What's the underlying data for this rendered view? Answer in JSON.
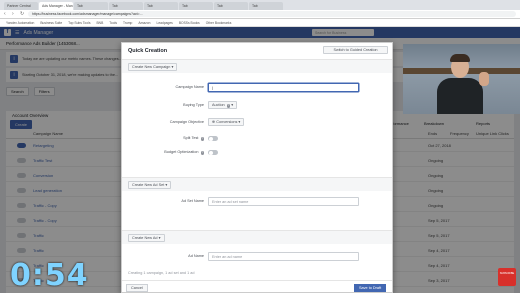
{
  "browser": {
    "tabs": [
      "Partner Central",
      "Ads Manager - Manage Ads",
      "Tab",
      "Tab",
      "Tab",
      "Tab",
      "Tab",
      "Tab"
    ],
    "url": "https://business.facebook.com/adsmanager/manage/campaigns?act=...",
    "bookmarks": [
      "Yandex Automation",
      "Business Suite",
      "Top Subs Tools",
      "BNB",
      "Tools",
      "Trump",
      "Amazon",
      "Leadpages",
      "BOSSs Books",
      "Other Bookmarks"
    ]
  },
  "fb": {
    "app_title": "Ads Manager",
    "search_placeholder": "Search for Business",
    "account_name": "Performance Ads Builder (1453068...",
    "notice_1": "Today we are updating our metric names. These changes...",
    "notice_2": "Starting October 31, 2018, we're making updates to the...",
    "search_btn": "Search",
    "filters_btn": "Filters",
    "date_range": "This month: Oct 1, 2018 - Oct 22, 2018",
    "account_overview": "Account Overview",
    "create_btn": "Create",
    "col_campaign": "Campaign Name",
    "col_ends": "Ends",
    "col_frequency": "Frequency",
    "col_unique": "Unique Link Clicks",
    "performance": "Performance",
    "breakdown": "Breakdown",
    "reports": "Reports",
    "rows": [
      {
        "name": "Retargeting",
        "ends": "Oct 27, 2018",
        "on": true
      },
      {
        "name": "Traffic Test",
        "ends": "Ongoing",
        "on": false
      },
      {
        "name": "Conversion",
        "ends": "Ongoing",
        "on": false
      },
      {
        "name": "Lead generation",
        "ends": "Ongoing",
        "on": false
      },
      {
        "name": "Traffic - Copy",
        "ends": "Ongoing",
        "on": false
      },
      {
        "name": "Traffic - Copy",
        "ends": "Sep 5, 2017",
        "on": false
      },
      {
        "name": "Traffic",
        "ends": "Sep 5, 2017",
        "on": false
      },
      {
        "name": "Traffic",
        "ends": "Sep 4, 2017",
        "on": false
      },
      {
        "name": "Traffic",
        "ends": "Sep 4, 2017",
        "on": false
      },
      {
        "name": "Traffic",
        "ends": "Sep 3, 2017",
        "on": false
      }
    ]
  },
  "modal": {
    "title": "Quick Creation",
    "switch_guided": "Switch to Guided Creation",
    "create_campaign": "Create New Campaign",
    "campaign_name_label": "Campaign Name",
    "campaign_name_value": "|",
    "buying_type_label": "Buying Type",
    "buying_type_value": "Auction",
    "objective_label": "Campaign Objective",
    "objective_value": "Conversions",
    "split_test_label": "Split Test",
    "budget_opt_label": "Budget Optimization",
    "create_adset": "Create New Ad Set",
    "adset_name_label": "Ad Set Name",
    "adset_name_placeholder": "Enter an ad set name",
    "create_ad": "Create New Ad",
    "ad_name_label": "Ad Name",
    "ad_name_placeholder": "Enter an ad name",
    "summary": "Creating 1 campaign, 1 ad set and 1 ad",
    "cancel": "Cancel",
    "save": "Save to Draft"
  },
  "overlay": {
    "timer": "0:54",
    "badge": "SUBSCRIBE"
  },
  "colors": {
    "fb_blue": "#4267b2",
    "timer": "#7fd3ff"
  }
}
